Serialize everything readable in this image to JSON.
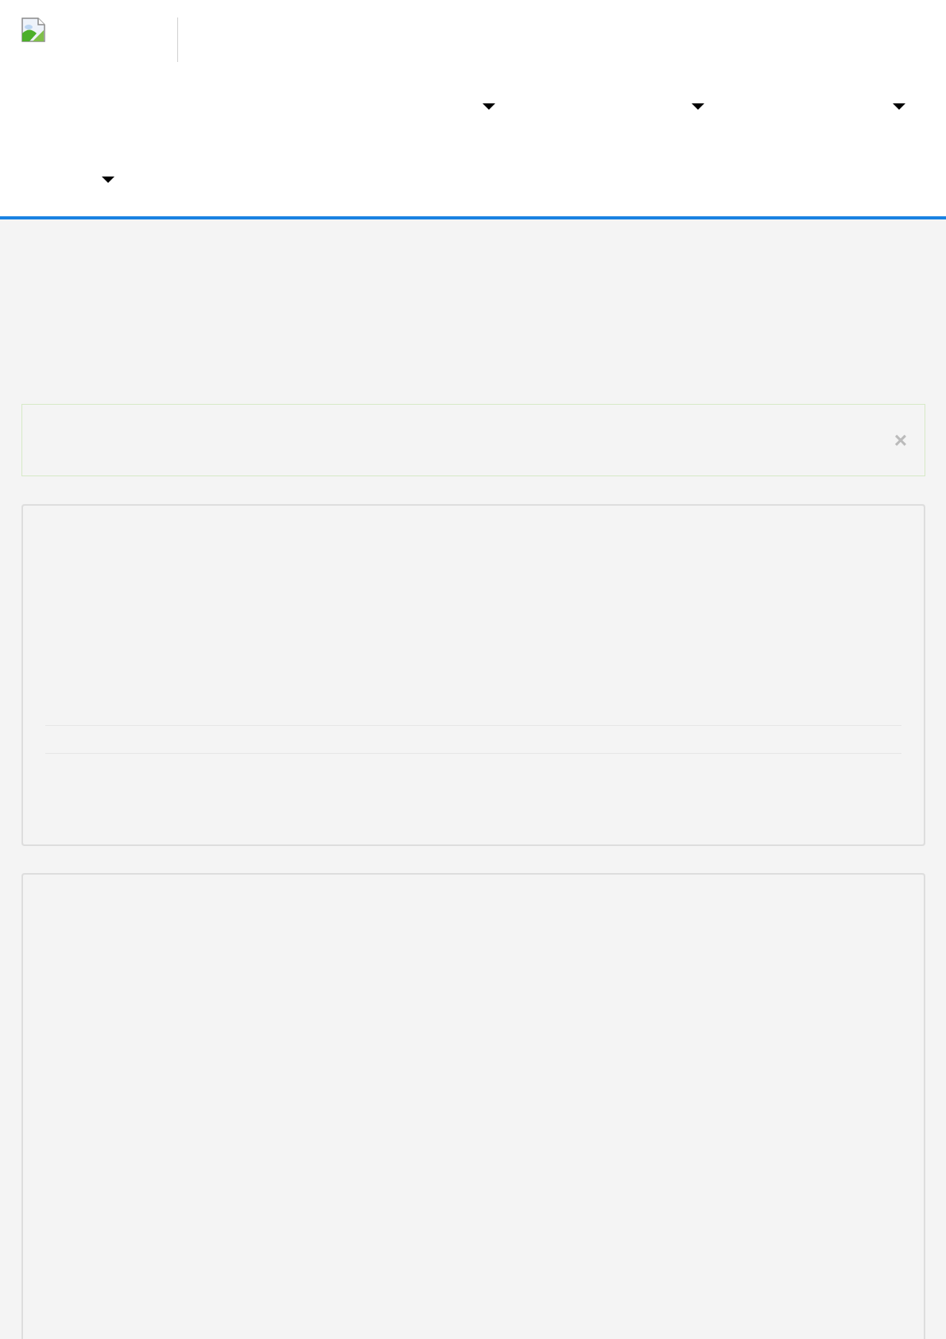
{
  "nav": {
    "menus": [
      {
        "kind": "dropdown"
      },
      {
        "kind": "dropdown"
      },
      {
        "kind": "dropdown"
      },
      {
        "kind": "dropdown"
      }
    ]
  },
  "alert": {
    "close": "×"
  }
}
